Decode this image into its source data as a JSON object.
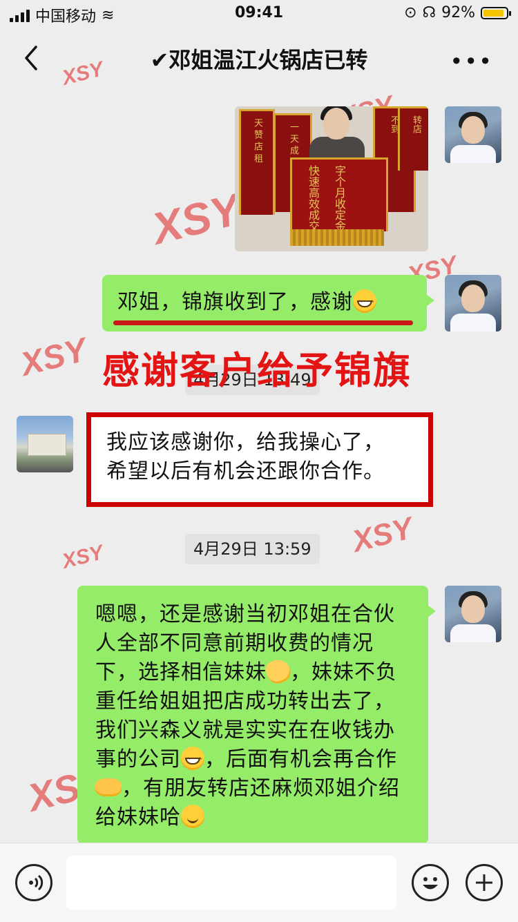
{
  "status_bar": {
    "carrier": "中国移动",
    "time": "09:41",
    "battery_percent": "92%",
    "battery_level": 0.92
  },
  "nav": {
    "title": "✔邓姐温江火锅店已转",
    "more": "•••"
  },
  "watermark_text": "XSY",
  "messages": [
    {
      "from": "me",
      "type": "image",
      "banner_texts": [
        "不到",
        "快速",
        "快速高效成交",
        "字个月收定金",
        "转店"
      ]
    },
    {
      "from": "me",
      "type": "text",
      "text": "邓姐，锦旗收到了，感谢"
    },
    {
      "from": "other",
      "type": "text",
      "lines": [
        "我应该感谢你，给我操心了，",
        "希望以后有机会还跟你合作。"
      ]
    },
    {
      "from": "me",
      "type": "text",
      "parts": [
        "嗯嗯，还是感谢当初邓姐在合伙人全部不同意前期收费的情况下，选择相信妹妹",
        "，妹妹不负重任给姐姐把店成功转出去了，我们兴森义就是实实在在收钱办事的公司",
        "，后面有机会再合作",
        "，有朋友转店还麻烦邓姐介绍给妹妹哈"
      ]
    }
  ],
  "overlay_caption": "感谢客户给予锦旗",
  "timestamps": [
    "4月29日 13:49",
    "4月29日 13:59"
  ],
  "emoji_names": [
    "grinning-face",
    "ok-hand",
    "handshake",
    "hugging-face"
  ],
  "input": {
    "placeholder": ""
  }
}
